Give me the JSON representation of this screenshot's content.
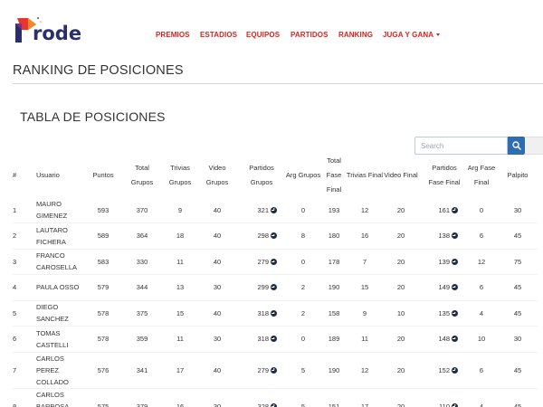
{
  "brand": {
    "logo_text": "rode",
    "logo_colors": [
      "#e8362f",
      "#f08a24",
      "#7a2e8e",
      "#2a2f6b"
    ]
  },
  "nav": {
    "items": [
      "PREMIOS",
      "ESTADIOS",
      "EQUIPOS",
      "PARTIDOS",
      "RANKING",
      "JUGA Y GANA"
    ],
    "color": "#d6221f"
  },
  "page": {
    "title": "RANKING DE POSICIONES",
    "section_title": "TABLA DE POSICIONES"
  },
  "search": {
    "placeholder": "Search",
    "icon": "search-icon",
    "button_color": "#2f6db3"
  },
  "table": {
    "columns": [
      {
        "key": "pos",
        "label": "#"
      },
      {
        "key": "user",
        "label": "Usuario"
      },
      {
        "key": "points",
        "label": "Puntos"
      },
      {
        "key": "total_groups",
        "label": "Total Grupos"
      },
      {
        "key": "trivia_groups",
        "label": "Trivias Grupos"
      },
      {
        "key": "video_groups",
        "label": "Video Grupos"
      },
      {
        "key": "matches_groups",
        "label": "Partidos Grupos"
      },
      {
        "key": "arg_groups",
        "label": "Arg Grupos"
      },
      {
        "key": "total_final",
        "label": "Total Fase Final"
      },
      {
        "key": "trivia_final",
        "label": "Trivias Final"
      },
      {
        "key": "video_final",
        "label": "Video Final"
      },
      {
        "key": "matches_final",
        "label": "Partidos Fase Final"
      },
      {
        "key": "arg_final",
        "label": "Arg Fase Final"
      },
      {
        "key": "palpito",
        "label": "Palpito"
      }
    ],
    "link_icon": "arrow-circle-right-icon",
    "rows": [
      {
        "pos": "1",
        "user": "MAURO GIMENEZ",
        "points": "593",
        "total_groups": "370",
        "trivia_groups": "9",
        "video_groups": "40",
        "matches_groups": "321",
        "arg_groups": "0",
        "total_final": "193",
        "trivia_final": "12",
        "video_final": "20",
        "matches_final": "161",
        "arg_final": "0",
        "palpito": "30"
      },
      {
        "pos": "2",
        "user": "LAUTARO FICHERA",
        "points": "589",
        "total_groups": "364",
        "trivia_groups": "18",
        "video_groups": "40",
        "matches_groups": "298",
        "arg_groups": "8",
        "total_final": "180",
        "trivia_final": "16",
        "video_final": "20",
        "matches_final": "138",
        "arg_final": "6",
        "palpito": "45"
      },
      {
        "pos": "3",
        "user": "FRANCO CAROSELLA",
        "points": "583",
        "total_groups": "330",
        "trivia_groups": "11",
        "video_groups": "40",
        "matches_groups": "279",
        "arg_groups": "0",
        "total_final": "178",
        "trivia_final": "7",
        "video_final": "20",
        "matches_final": "139",
        "arg_final": "12",
        "palpito": "75"
      },
      {
        "pos": "4",
        "user": "PAULA OSSO",
        "points": "579",
        "total_groups": "344",
        "trivia_groups": "13",
        "video_groups": "30",
        "matches_groups": "299",
        "arg_groups": "2",
        "total_final": "190",
        "trivia_final": "15",
        "video_final": "20",
        "matches_final": "149",
        "arg_final": "6",
        "palpito": "45"
      },
      {
        "pos": "5",
        "user": "DIEGO SANCHEZ",
        "points": "578",
        "total_groups": "375",
        "trivia_groups": "15",
        "video_groups": "40",
        "matches_groups": "318",
        "arg_groups": "2",
        "total_final": "158",
        "trivia_final": "9",
        "video_final": "10",
        "matches_final": "135",
        "arg_final": "4",
        "palpito": "45"
      },
      {
        "pos": "6",
        "user": "TOMAS CASTELLI",
        "points": "578",
        "total_groups": "359",
        "trivia_groups": "11",
        "video_groups": "30",
        "matches_groups": "318",
        "arg_groups": "0",
        "total_final": "189",
        "trivia_final": "11",
        "video_final": "20",
        "matches_final": "148",
        "arg_final": "10",
        "palpito": "30"
      },
      {
        "pos": "7",
        "user": "CARLOS PEREZ COLLADO",
        "points": "576",
        "total_groups": "341",
        "trivia_groups": "17",
        "video_groups": "40",
        "matches_groups": "279",
        "arg_groups": "5",
        "total_final": "190",
        "trivia_final": "12",
        "video_final": "20",
        "matches_final": "152",
        "arg_final": "6",
        "palpito": "45"
      },
      {
        "pos": "8",
        "user": "CARLOS BARBOSA MARIANO",
        "points": "575",
        "total_groups": "379",
        "trivia_groups": "16",
        "video_groups": "30",
        "matches_groups": "328",
        "arg_groups": "5",
        "total_final": "151",
        "trivia_final": "17",
        "video_final": "20",
        "matches_final": "110",
        "arg_final": "4",
        "palpito": "45"
      }
    ]
  }
}
